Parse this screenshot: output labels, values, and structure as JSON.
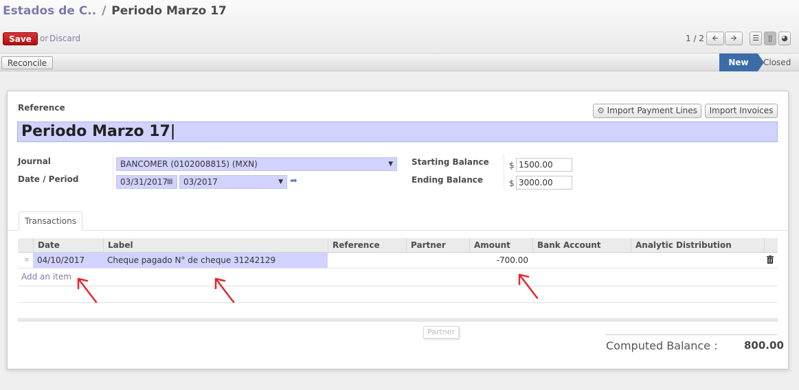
{
  "breadcrumb": {
    "parent": "Estados de C..",
    "separator": "/",
    "current": "Periodo Marzo 17"
  },
  "toolbar": {
    "save_label": "Save",
    "or_label": "or",
    "discard_label": "Discard",
    "pager": "1 / 2"
  },
  "statusbar": {
    "reconcile_label": "Reconcile",
    "states": [
      "New",
      "Closed"
    ],
    "active_state": "New"
  },
  "form": {
    "reference_label": "Reference",
    "reference_value": "Periodo Marzo 17",
    "import_payment_lines_label": "Import Payment Lines",
    "import_invoices_label": "Import Invoices",
    "journal_label": "Journal",
    "journal_value": "BANCOMER (0102008815) (MXN)",
    "date_period_label": "Date / Period",
    "date_value": "03/31/2017",
    "period_value": "03/2017",
    "starting_balance_label": "Starting Balance",
    "starting_balance_currency": "$",
    "starting_balance_value": "1500.00",
    "ending_balance_label": "Ending Balance",
    "ending_balance_currency": "$",
    "ending_balance_value": "3000.00"
  },
  "tabs": [
    {
      "label": "Transactions"
    }
  ],
  "table": {
    "columns": [
      "Date",
      "Label",
      "Reference",
      "Partner",
      "Amount",
      "Bank Account",
      "Analytic Distribution"
    ],
    "rows": [
      {
        "date": "04/10/2017",
        "label": "Cheque pagado N° de cheque 31242129",
        "reference": "",
        "partner": "",
        "amount": "-700.00",
        "bank_account": "",
        "analytic": ""
      }
    ],
    "add_item_label": "Add an item"
  },
  "tooltip": "Partner",
  "computed_balance": {
    "label": "Computed Balance :",
    "value": "800.00"
  },
  "colors": {
    "accent": "#7c7bad",
    "save": "#c9201e",
    "state_active": "#3c6ca8",
    "field_highlight": "#d2d2ff",
    "annotation_arrow": "#e8262a"
  }
}
